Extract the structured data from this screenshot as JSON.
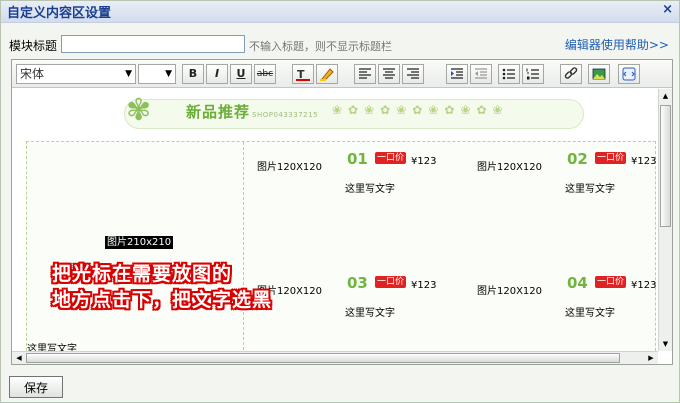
{
  "dialog": {
    "title": "自定义内容区设置",
    "close": "×"
  },
  "form": {
    "label": "模块标题",
    "input_value": "",
    "hint": "不输入标题，则不显示标题栏",
    "help_link": "编辑器使用帮助>>"
  },
  "toolbar": {
    "font_value": "宋体",
    "size_value": "",
    "buttons": [
      "bold",
      "italic",
      "underline",
      "strikethrough",
      "font-color",
      "highlight",
      "align-left",
      "align-center",
      "align-right",
      "indent",
      "outdent",
      "unordered-list",
      "ordered-list",
      "link",
      "image",
      "source"
    ],
    "bold_label": "B",
    "italic_label": "I",
    "underline_label": "U",
    "strike_label": "abc"
  },
  "content": {
    "banner_title": "新品推荐",
    "banner_sub": "SHOP043337215",
    "big_pic_label": "图片210x210",
    "bottom_text": "这里写文字",
    "items": [
      {
        "num": "01",
        "price_tag": "一口价",
        "price": "¥123",
        "pic": "图片120X120",
        "desc": "这里写文字"
      },
      {
        "num": "02",
        "price_tag": "一口价",
        "price": "¥123",
        "pic": "图片120X120",
        "desc": "这里写文字"
      },
      {
        "num": "03",
        "price_tag": "一口价",
        "price": "¥123",
        "pic": "图片120X120",
        "desc": "这里写文字"
      },
      {
        "num": "04",
        "price_tag": "一口价",
        "price": "¥123",
        "pic": "图片120X120",
        "desc": "这里写文字"
      }
    ],
    "note_line1": "把光标在需要放图的",
    "note_line2": "地方点击下，把文字选黑"
  },
  "footer": {
    "save_label": "保存"
  },
  "colors": {
    "accent_green": "#71b43f",
    "price_red": "#e02222",
    "note_red": "#d90000",
    "link_blue": "#1f5fb3"
  }
}
